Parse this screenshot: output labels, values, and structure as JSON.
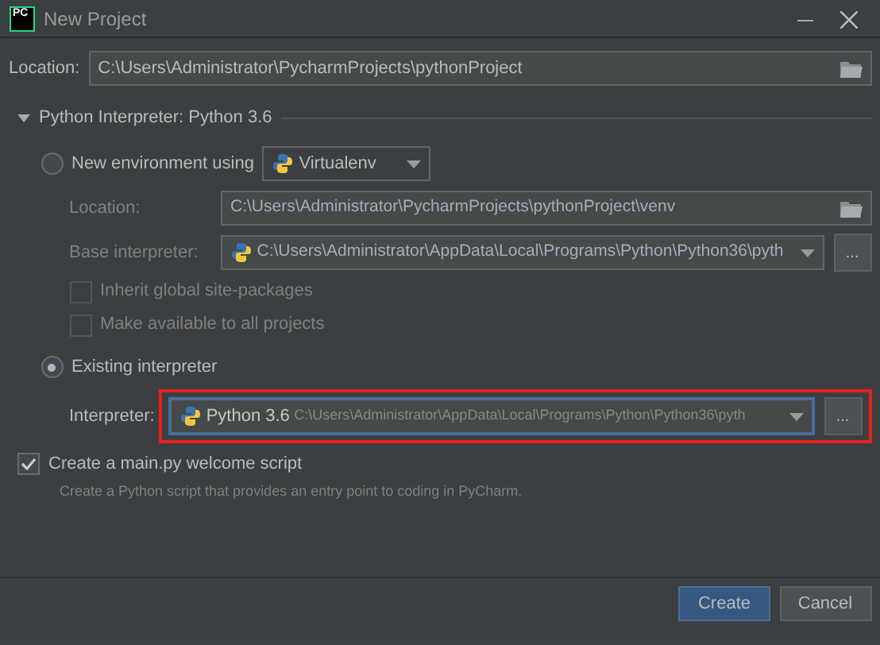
{
  "window": {
    "title": "New Project",
    "logo": "PC"
  },
  "location": {
    "label": "Location:",
    "value": "C:\\Users\\Administrator\\PycharmProjects\\pythonProject"
  },
  "section": {
    "title": "Python Interpreter: Python 3.6",
    "expanded": true
  },
  "new_environment": {
    "label": "New environment using",
    "selected": false,
    "tool": "Virtualenv",
    "location": {
      "label": "Location:",
      "value": "C:\\Users\\Administrator\\PycharmProjects\\pythonProject\\venv",
      "disabled": true
    },
    "base_interpreter": {
      "label": "Base interpreter:",
      "value": "C:\\Users\\Administrator\\AppData\\Local\\Programs\\Python\\Python36\\pyth",
      "disabled": true,
      "button": "..."
    },
    "options": [
      {
        "label": "Inherit global site-packages",
        "checked": false,
        "disabled": true
      },
      {
        "label": "Make available to all projects",
        "checked": false,
        "disabled": true
      }
    ]
  },
  "existing_interpreter": {
    "label": "Existing interpreter",
    "selected": true,
    "field_label": "Interpreter:",
    "name": "Python 3.6",
    "path": "C:\\Users\\Administrator\\AppData\\Local\\Programs\\Python\\Python36\\pyth",
    "button": "...",
    "highlighted": true
  },
  "welcome_script": {
    "label": "Create a main.py welcome script",
    "checked": true,
    "description": "Create a Python script that provides an entry point to coding in PyCharm."
  },
  "buttons": [
    {
      "label": "Create",
      "primary": true
    },
    {
      "label": "Cancel",
      "primary": false
    }
  ]
}
